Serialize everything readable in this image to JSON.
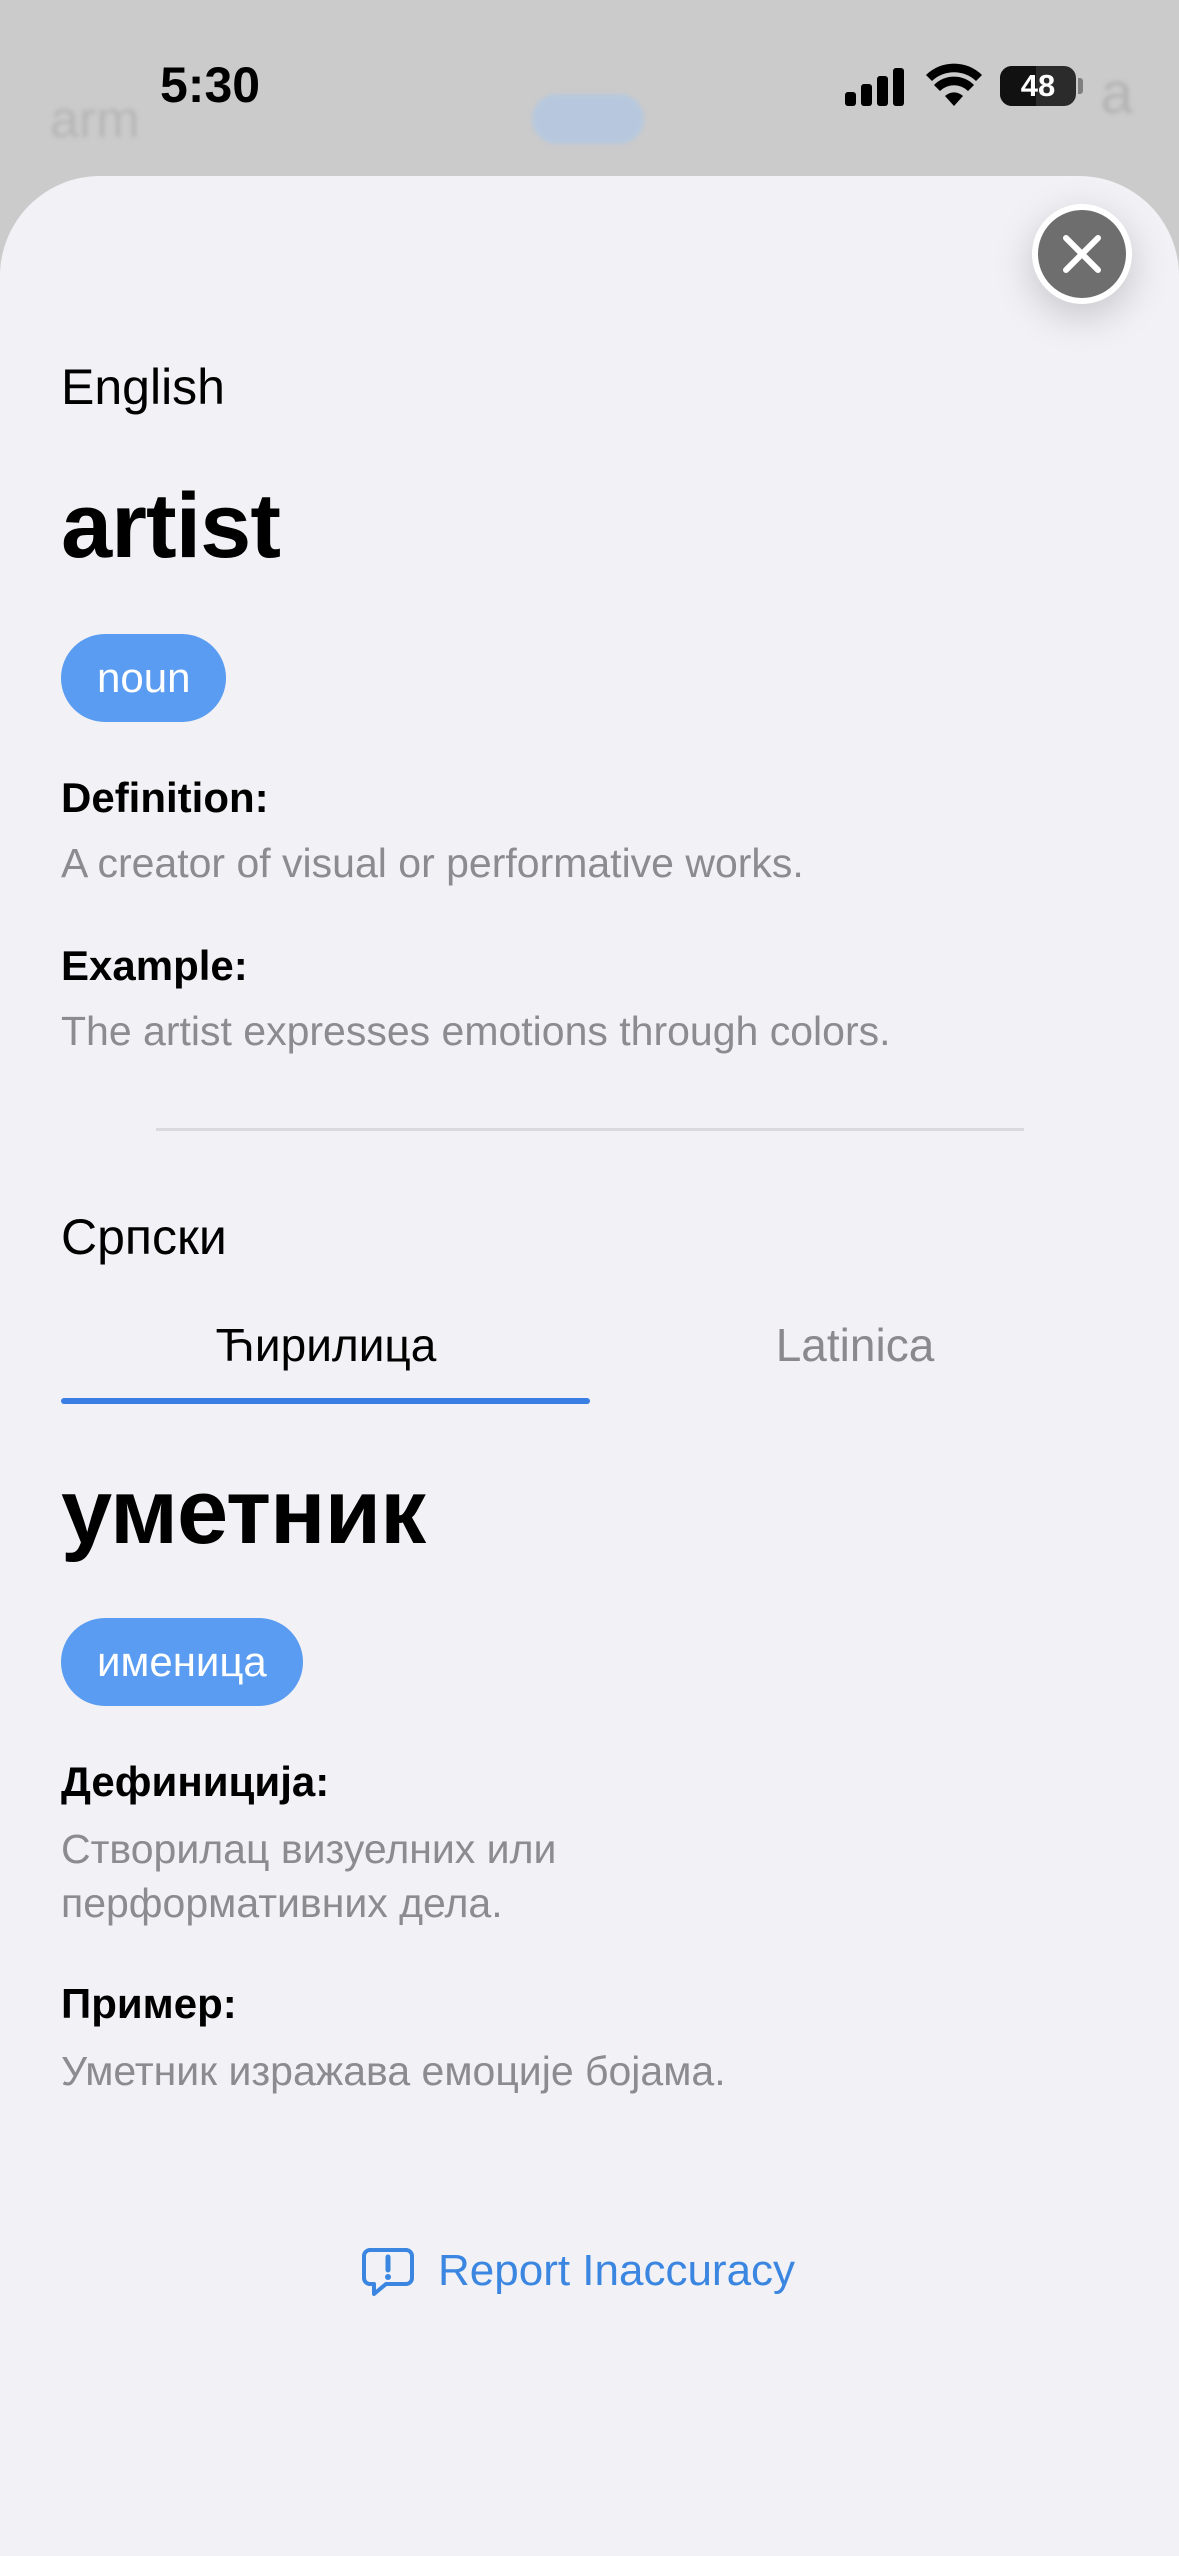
{
  "status_bar": {
    "time": "5:30",
    "battery": "48",
    "battery_level": 0.48
  },
  "background": {
    "left_text": "arm",
    "right_text": "a"
  },
  "english": {
    "language": "English",
    "word": "artist",
    "pos": "noun",
    "definition_label": "Definition:",
    "definition": "A creator of visual or performative works.",
    "example_label": "Example:",
    "example": "The artist expresses emotions through colors."
  },
  "serbian": {
    "language": "Српски",
    "tabs": [
      {
        "label": "Ћирилица",
        "selected": true
      },
      {
        "label": "Latinica",
        "selected": false
      }
    ],
    "word": "уметник",
    "pos": "именица",
    "definition_label": "Дефиниција:",
    "definition_line1": "Створилац визуелних или",
    "definition_line2": "перформативних дела.",
    "example_label": "Пример:",
    "example": "Уметник изражава емоције бојама."
  },
  "report_label": "Report Inaccuracy",
  "colors": {
    "accent": "#3a86e0",
    "pill": "#5a9cf1",
    "sheet": "#f1f1f6",
    "muted": "#8c8c90"
  }
}
